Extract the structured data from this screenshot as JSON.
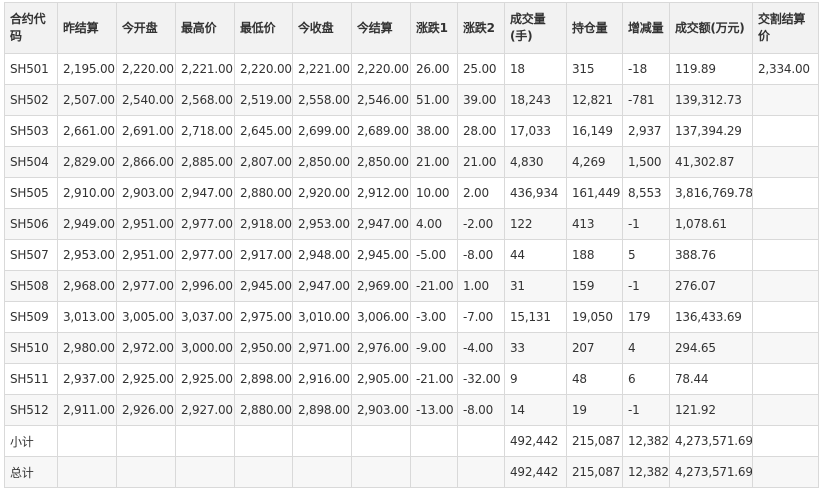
{
  "headers": [
    "合约代码",
    "昨结算",
    "今开盘",
    "最高价",
    "最低价",
    "今收盘",
    "今结算",
    "涨跌1",
    "涨跌2",
    "成交量(手)",
    "持仓量",
    "增减量",
    "成交额(万元)",
    "交割结算价"
  ],
  "rows": [
    [
      "SH501",
      "2,195.00",
      "2,220.00",
      "2,221.00",
      "2,220.00",
      "2,221.00",
      "2,220.00",
      "26.00",
      "25.00",
      "18",
      "315",
      "-18",
      "119.89",
      "2,334.00"
    ],
    [
      "SH502",
      "2,507.00",
      "2,540.00",
      "2,568.00",
      "2,519.00",
      "2,558.00",
      "2,546.00",
      "51.00",
      "39.00",
      "18,243",
      "12,821",
      "-781",
      "139,312.73",
      ""
    ],
    [
      "SH503",
      "2,661.00",
      "2,691.00",
      "2,718.00",
      "2,645.00",
      "2,699.00",
      "2,689.00",
      "38.00",
      "28.00",
      "17,033",
      "16,149",
      "2,937",
      "137,394.29",
      ""
    ],
    [
      "SH504",
      "2,829.00",
      "2,866.00",
      "2,885.00",
      "2,807.00",
      "2,850.00",
      "2,850.00",
      "21.00",
      "21.00",
      "4,830",
      "4,269",
      "1,500",
      "41,302.87",
      ""
    ],
    [
      "SH505",
      "2,910.00",
      "2,903.00",
      "2,947.00",
      "2,880.00",
      "2,920.00",
      "2,912.00",
      "10.00",
      "2.00",
      "436,934",
      "161,449",
      "8,553",
      "3,816,769.78",
      ""
    ],
    [
      "SH506",
      "2,949.00",
      "2,951.00",
      "2,977.00",
      "2,918.00",
      "2,953.00",
      "2,947.00",
      "4.00",
      "-2.00",
      "122",
      "413",
      "-1",
      "1,078.61",
      ""
    ],
    [
      "SH507",
      "2,953.00",
      "2,951.00",
      "2,977.00",
      "2,917.00",
      "2,948.00",
      "2,945.00",
      "-5.00",
      "-8.00",
      "44",
      "188",
      "5",
      "388.76",
      ""
    ],
    [
      "SH508",
      "2,968.00",
      "2,977.00",
      "2,996.00",
      "2,945.00",
      "2,947.00",
      "2,969.00",
      "-21.00",
      "1.00",
      "31",
      "159",
      "-1",
      "276.07",
      ""
    ],
    [
      "SH509",
      "3,013.00",
      "3,005.00",
      "3,037.00",
      "2,975.00",
      "3,010.00",
      "3,006.00",
      "-3.00",
      "-7.00",
      "15,131",
      "19,050",
      "179",
      "136,433.69",
      ""
    ],
    [
      "SH510",
      "2,980.00",
      "2,972.00",
      "3,000.00",
      "2,950.00",
      "2,971.00",
      "2,976.00",
      "-9.00",
      "-4.00",
      "33",
      "207",
      "4",
      "294.65",
      ""
    ],
    [
      "SH511",
      "2,937.00",
      "2,925.00",
      "2,925.00",
      "2,898.00",
      "2,916.00",
      "2,905.00",
      "-21.00",
      "-32.00",
      "9",
      "48",
      "6",
      "78.44",
      ""
    ],
    [
      "SH512",
      "2,911.00",
      "2,926.00",
      "2,927.00",
      "2,880.00",
      "2,898.00",
      "2,903.00",
      "-13.00",
      "-8.00",
      "14",
      "19",
      "-1",
      "121.92",
      ""
    ],
    [
      "小计",
      "",
      "",
      "",
      "",
      "",
      "",
      "",
      "",
      "492,442",
      "215,087",
      "12,382",
      "4,273,571.69",
      ""
    ],
    [
      "总计",
      "",
      "",
      "",
      "",
      "",
      "",
      "",
      "",
      "492,442",
      "215,087",
      "12,382",
      "4,273,571.69",
      ""
    ]
  ]
}
